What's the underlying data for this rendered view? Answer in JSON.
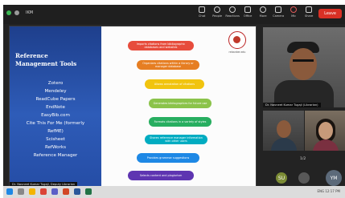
{
  "toolbar": {
    "meeting_title": "IKM",
    "buttons": [
      {
        "label": "Chat",
        "icon": "chat-icon"
      },
      {
        "label": "People",
        "icon": "people-icon"
      },
      {
        "label": "Reactions",
        "icon": "reactions-icon"
      },
      {
        "label": "Office",
        "icon": "office-icon"
      },
      {
        "label": "More",
        "icon": "more-icon"
      },
      {
        "label": "Camera",
        "icon": "camera-icon"
      },
      {
        "label": "Mic",
        "icon": "mic-icon"
      },
      {
        "label": "Share",
        "icon": "share-icon"
      }
    ],
    "leave_label": "Leave"
  },
  "slide": {
    "title_line1": "Reference",
    "title_line2": "Management Tools",
    "tools": [
      "Zotero",
      "Mendeley",
      "ReadCube Papers",
      "EndNote",
      "EasyBib.com",
      "Cite This For Me (formerly",
      "RefME)",
      "Scisheet",
      "RefWorks",
      "Reference Manager"
    ],
    "logo_caption": "rebanker.edu",
    "features": [
      "Imports citations from bibliographic databases and websites",
      "Organizes citations within a library or manager database",
      "Allows annotation of citations",
      "Generates bibliographies for future use",
      "Formats citations in a variety of styles",
      "Shares reference manager information with other users",
      "Provides grammar suggestions",
      "Selects content and plagiarism"
    ],
    "colors": [
      "#e74c3c",
      "#e67e22",
      "#f1c40f",
      "#8bc34a",
      "#27ae60",
      "#00acc1",
      "#1e88e5",
      "#5e35b1"
    ],
    "presenter_tag": "Dr. Navneet Kumar Tugaji, Deputy Librarian"
  },
  "participants": {
    "main_label": "Dr. Navneet Kumar Tugaji (Librarian)",
    "pager": "1/2",
    "avatars": [
      {
        "initials": "SU",
        "color": "#7b8b34"
      },
      {
        "initials": "",
        "color": "#585858"
      },
      {
        "initials": "YM",
        "color": "#5c6a7a"
      }
    ]
  },
  "taskbar": {
    "tray": "ENG  12:17 PM"
  }
}
